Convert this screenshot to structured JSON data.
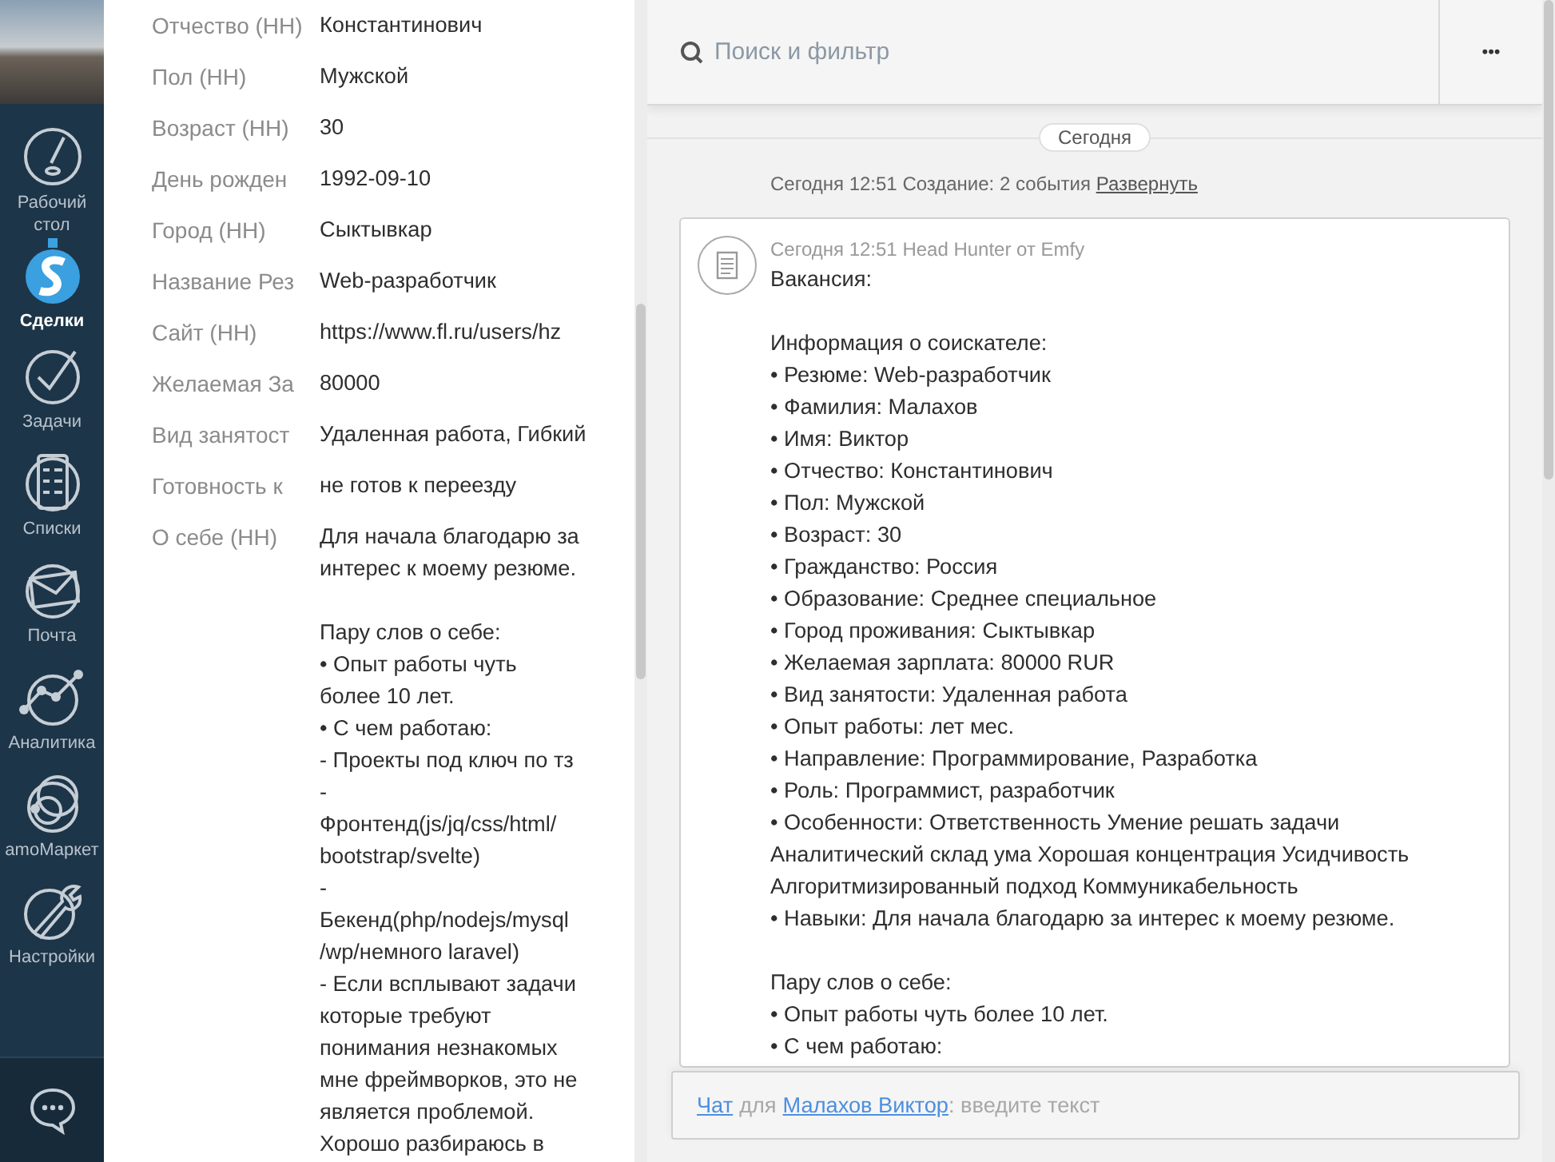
{
  "sidebar": {
    "items": [
      {
        "label": "Рабочий стол",
        "kind": "dashboard",
        "selected": false
      },
      {
        "label": "Сделки",
        "kind": "deals",
        "selected": true
      },
      {
        "label": "Задачи",
        "kind": "tasks",
        "selected": false
      },
      {
        "label": "Списки",
        "kind": "lists",
        "selected": false
      },
      {
        "label": "Почта",
        "kind": "mail",
        "selected": false
      },
      {
        "label": "Аналитика",
        "kind": "analytics",
        "selected": false
      },
      {
        "label": "amoМаркет",
        "kind": "market",
        "selected": false
      },
      {
        "label": "Настройки",
        "kind": "settings",
        "selected": false
      }
    ]
  },
  "fields": [
    {
      "label": "Отчество (НН)",
      "value": "Константинович"
    },
    {
      "label": "Пол (НН)",
      "value": "Мужской"
    },
    {
      "label": "Возраст (НН)",
      "value": "30"
    },
    {
      "label": "День рожден",
      "value": "1992-09-10"
    },
    {
      "label": "Город (НН)",
      "value": "Сыктывкар"
    },
    {
      "label": "Название Рез",
      "value": "Web-разработчик"
    },
    {
      "label": "Сайт (НН)",
      "value": "https://www.fl.ru/users/hz"
    },
    {
      "label": "Желаемая За",
      "value": "80000"
    },
    {
      "label": "Вид занятост",
      "value": "Удаленная работа, Гибкий"
    },
    {
      "label": "Готовность к",
      "value": "не готов к переезду"
    },
    {
      "label": "О себе (НН)",
      "value": "Для начала благодарю за\nинтерес к моему резюме.\n\nПару слов о себе:\n• Опыт работы чуть\nболее 10 лет.\n• С чем работаю:\n- Проекты под ключ по тз\n-\nФронтенд(js/jq/css/html/\nbootstrap/svelte)\n-\nБекенд(php/nodejs/mysql\n/wp/немного laravel)\n- Если всплывают задачи\nкоторые требуют\nпонимания незнакомых\nмне фреймворков, это не\nявляется проблемой.\nХорошо разбираюсь в"
    }
  ],
  "feed": {
    "search": {
      "placeholder": "Поиск и фильтр"
    },
    "more_button": "•••",
    "date_divider": "Сегодня",
    "event_summary": {
      "text": "Сегодня 12:51 Создание: 2 события",
      "link": "Развернуть"
    },
    "message": {
      "meta": "Сегодня 12:51 Head Hunter от Emfy",
      "body": "Вакансия:\n\nИнформация о соискателе:\n• Резюме: Web-разработчик\n• Фамилия: Малахов\n• Имя: Виктор\n• Отчество: Константинович\n• Пол: Мужской\n• Возраст: 30\n• Гражданство: Россия\n• Образование: Среднее специальное\n• Город проживания: Сыктывкар\n• Желаемая зарплата: 80000 RUR\n• Вид занятости: Удаленная работа\n• Опыт работы: лет мес.\n• Направление: Программирование, Разработка\n• Роль: Программист, разработчик\n• Особенности: Ответственность Умение решать задачи\nАналитический склад ума Хорошая концентрация Усидчивость\nАлгоритмизированный подход Коммуникабельность\n• Навыки: Для начала благодарю за интерес к моему резюме.\n\nПару слов о себе:\n• Опыт работы чуть более 10 лет.\n• С чем работаю:"
    },
    "chat_bar": {
      "chat_link": "Чат",
      "for_text": "для",
      "contact_link": "Малахов Виктор",
      "hint": ": введите текст"
    }
  }
}
